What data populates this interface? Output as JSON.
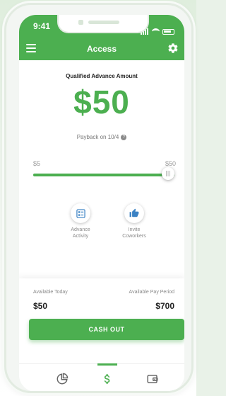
{
  "status_bar": {
    "time": "9:41"
  },
  "app_bar": {
    "title": "Access",
    "menu_icon": "hamburger-icon",
    "settings_icon": "gear-icon"
  },
  "main": {
    "heading": "Qualified Advance Amount",
    "amount": "$50",
    "payback": "Payback on 10/4",
    "help_icon": "question-circle-icon"
  },
  "slider": {
    "min_label": "$5",
    "max_label": "$50",
    "value": 50,
    "min": 5,
    "max": 50
  },
  "actions": [
    {
      "label_line1": "Advance",
      "label_line2": "Activity",
      "icon": "activity-list-icon"
    },
    {
      "label_line1": "Invite",
      "label_line2": "Coworkers",
      "icon": "thumbs-up-icon"
    }
  ],
  "summary": {
    "available_today_label": "Available Today",
    "available_today_value": "$50",
    "available_period_label": "Available Pay Period",
    "available_period_value": "$700",
    "cash_out_label": "CASH OUT"
  },
  "tabs": [
    {
      "icon": "pie-chart-icon",
      "active": false
    },
    {
      "icon": "dollar-icon",
      "active": true
    },
    {
      "icon": "wallet-icon",
      "active": false
    }
  ],
  "colors": {
    "primary": "#4caf50",
    "background": "#ffffff",
    "text_muted": "#888888"
  }
}
